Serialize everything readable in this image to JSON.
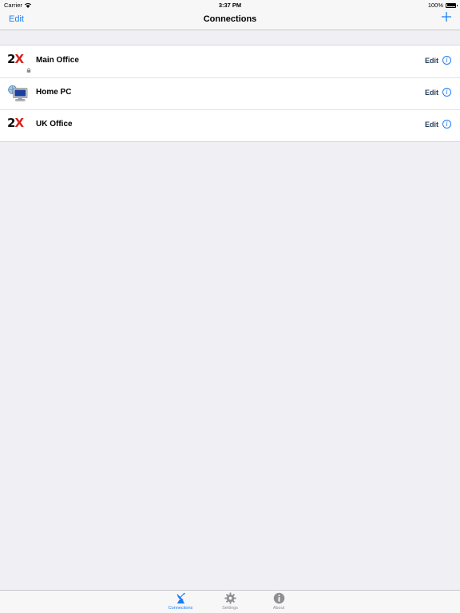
{
  "status_bar": {
    "carrier": "Carrier",
    "time": "3:37 PM",
    "battery": "100%",
    "battery_level": 1.0
  },
  "nav": {
    "edit_label": "Edit",
    "title": "Connections",
    "add_icon": "plus-icon"
  },
  "connections": [
    {
      "name": "Main Office",
      "icon": "2x-logo-icon",
      "locked": true,
      "edit_label": "Edit",
      "info_icon": "info-icon"
    },
    {
      "name": "Home PC",
      "icon": "computer-icon",
      "locked": false,
      "edit_label": "Edit",
      "info_icon": "info-icon"
    },
    {
      "name": "UK Office",
      "icon": "2x-logo-icon",
      "locked": false,
      "edit_label": "Edit",
      "info_icon": "info-icon"
    }
  ],
  "logo": {
    "digit": "2",
    "letter": "X"
  },
  "info_glyph": "i",
  "tabs": [
    {
      "label": "Connections",
      "icon": "satellite-dish-icon",
      "active": true
    },
    {
      "label": "Settings",
      "icon": "gear-icon",
      "active": false
    },
    {
      "label": "About",
      "icon": "info-icon",
      "active": false
    }
  ],
  "colors": {
    "accent": "#1a7cf5",
    "logo_red": "#d6221a",
    "background": "#efeff4"
  }
}
